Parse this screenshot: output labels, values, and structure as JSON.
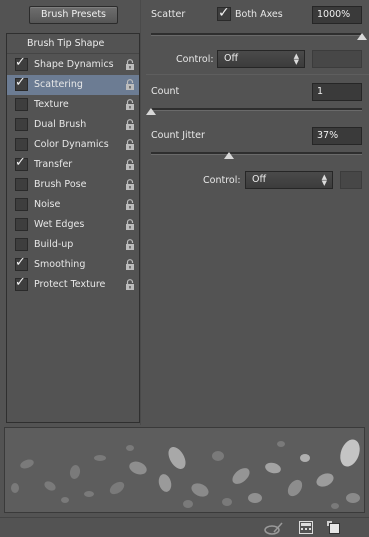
{
  "header": {
    "brush_presets_label": "Brush Presets"
  },
  "list": {
    "header": "Brush Tip Shape",
    "items": [
      {
        "label": "Shape Dynamics",
        "checked": true
      },
      {
        "label": "Scattering",
        "checked": true,
        "selected": true
      },
      {
        "label": "Texture",
        "checked": false
      },
      {
        "label": "Dual Brush",
        "checked": false
      },
      {
        "label": "Color Dynamics",
        "checked": false
      },
      {
        "label": "Transfer",
        "checked": true
      },
      {
        "label": "Brush Pose",
        "checked": false
      },
      {
        "label": "Noise",
        "checked": false
      },
      {
        "label": "Wet Edges",
        "checked": false
      },
      {
        "label": "Build-up",
        "checked": false
      },
      {
        "label": "Smoothing",
        "checked": true
      },
      {
        "label": "Protect Texture",
        "checked": true
      }
    ]
  },
  "scatter": {
    "label": "Scatter",
    "both_axes_label": "Both Axes",
    "both_axes_checked": true,
    "value": "1000%",
    "slider_fraction": 1.0,
    "control_label": "Control:",
    "control_value": "Off"
  },
  "count": {
    "label": "Count",
    "value": "1",
    "slider_fraction": 0.0
  },
  "count_jitter": {
    "label": "Count Jitter",
    "value": "37%",
    "slider_fraction": 0.37,
    "control_label": "Control:",
    "control_value": "Off"
  },
  "icons": {
    "tick": "✓",
    "dropdown_arrow": "▲▼"
  }
}
